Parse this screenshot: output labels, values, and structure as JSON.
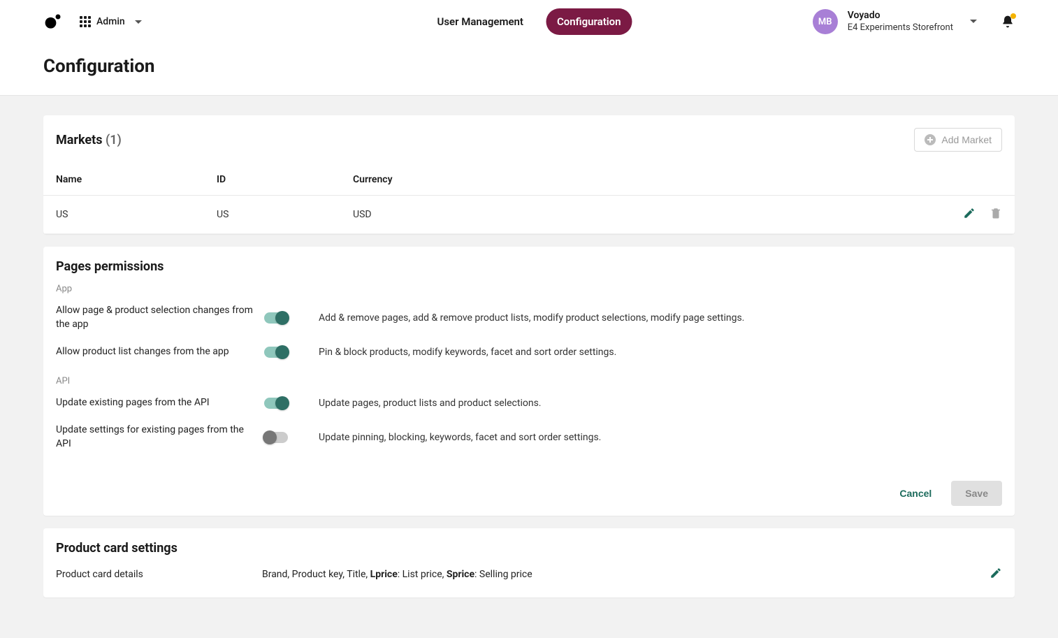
{
  "header": {
    "admin_label": "Admin",
    "tabs": [
      "User Management",
      "Configuration"
    ],
    "active_tab": 1,
    "user": {
      "initials": "MB",
      "name": "Voyado",
      "store": "E4 Experiments Storefront"
    }
  },
  "page": {
    "title": "Configuration"
  },
  "markets": {
    "title": "Markets",
    "count": "(1)",
    "add_label": "Add Market",
    "columns": [
      "Name",
      "ID",
      "Currency"
    ],
    "rows": [
      {
        "name": "US",
        "id": "US",
        "currency": "USD"
      }
    ]
  },
  "permissions": {
    "title": "Pages permissions",
    "groups": [
      {
        "label": "App",
        "items": [
          {
            "label": "Allow page & product selection changes from the app",
            "on": true,
            "desc": "Add & remove pages, add & remove product lists, modify product selections, modify page settings."
          },
          {
            "label": "Allow product list changes from the app",
            "on": true,
            "desc": "Pin & block products, modify keywords, facet and sort order settings."
          }
        ]
      },
      {
        "label": "API",
        "items": [
          {
            "label": "Update existing pages from the API",
            "on": true,
            "desc": "Update pages, product lists and product selections."
          },
          {
            "label": "Update settings for existing pages from the API",
            "on": false,
            "desc": "Update pinning, blocking, keywords, facet and sort order settings."
          }
        ]
      }
    ],
    "cancel": "Cancel",
    "save": "Save"
  },
  "product_card": {
    "title": "Product card settings",
    "label": "Product card details",
    "parts": {
      "prefix": "Brand,  Product key,  Title, ",
      "lprice_key": "Lprice",
      "lprice_desc": ": List price, ",
      "sprice_key": "Sprice",
      "sprice_desc": ": Selling price"
    }
  }
}
